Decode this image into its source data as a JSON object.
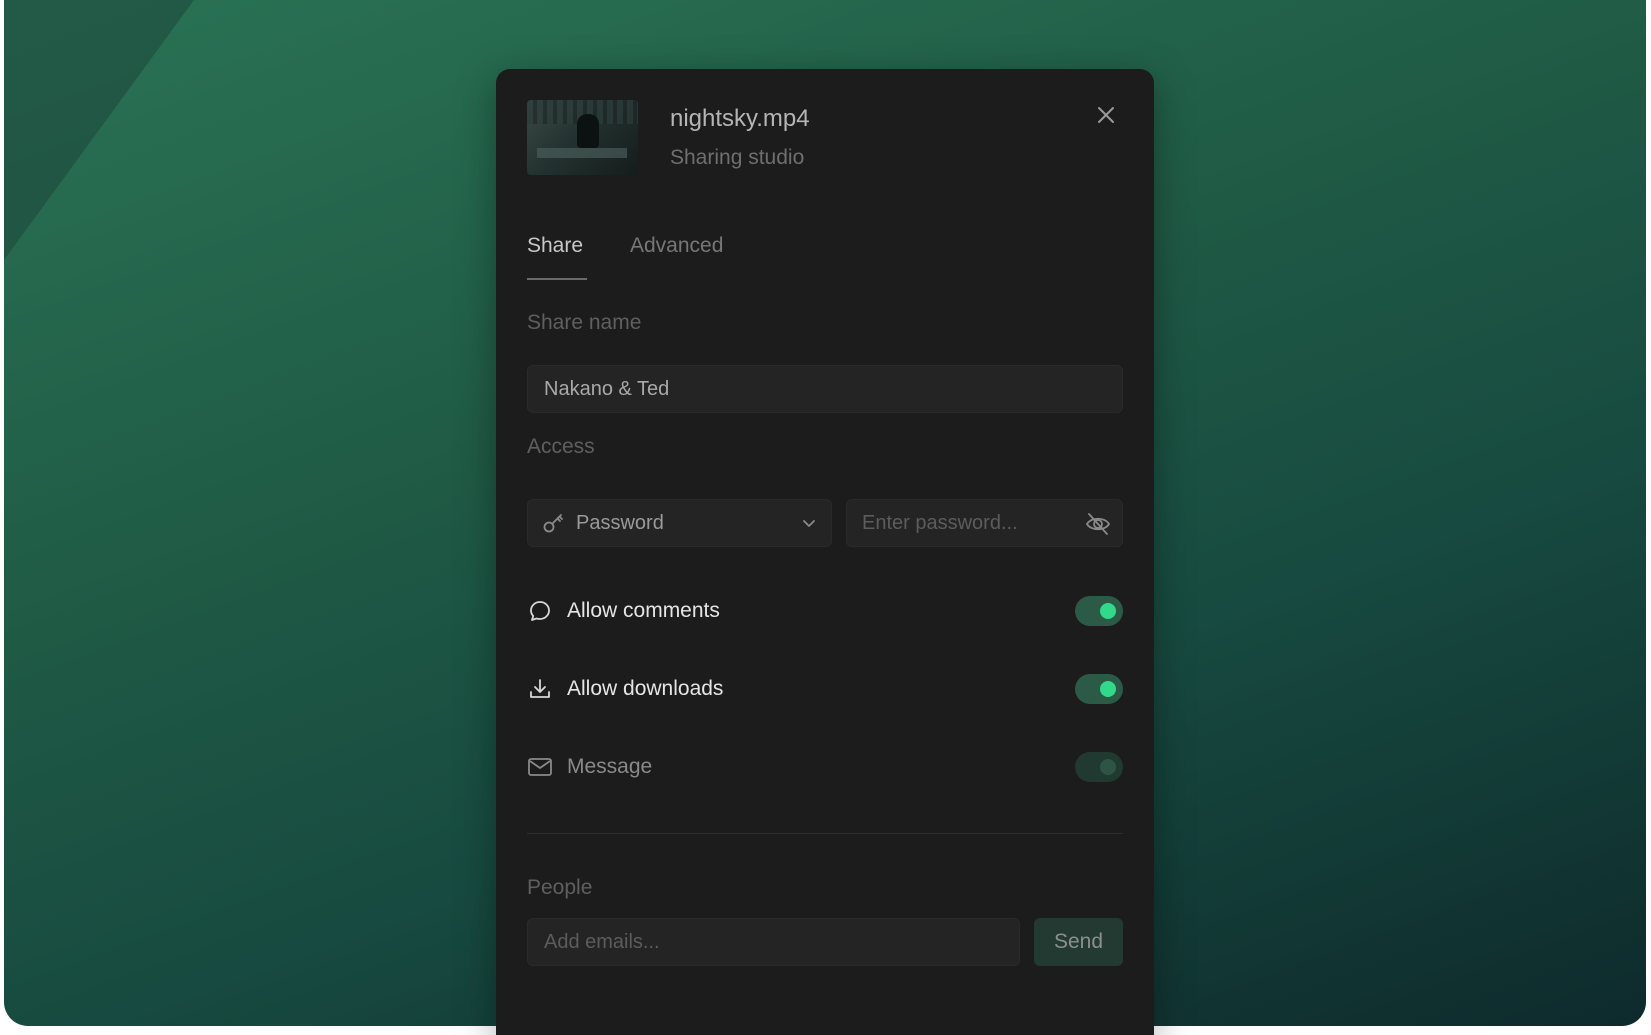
{
  "file": {
    "name": "nightsky.mp4",
    "subtitle": "Sharing studio",
    "thumbnail_icon": "video-thumbnail"
  },
  "tabs": [
    {
      "label": "Share",
      "active": true
    },
    {
      "label": "Advanced",
      "active": false
    }
  ],
  "share_name": {
    "label": "Share name",
    "value": "Nakano & Ted"
  },
  "access": {
    "label": "Access",
    "selected": "Password",
    "password_placeholder": "Enter password..."
  },
  "options": [
    {
      "label": "Allow comments",
      "icon": "comment-icon",
      "enabled": true
    },
    {
      "label": "Allow downloads",
      "icon": "download-icon",
      "enabled": true
    },
    {
      "label": "Message",
      "icon": "mail-icon",
      "enabled": false
    }
  ],
  "people": {
    "label": "People",
    "placeholder": "Add emails...",
    "send_label": "Send"
  },
  "colors": {
    "accent": "#33d98a",
    "panel": "#1c1c1c"
  }
}
